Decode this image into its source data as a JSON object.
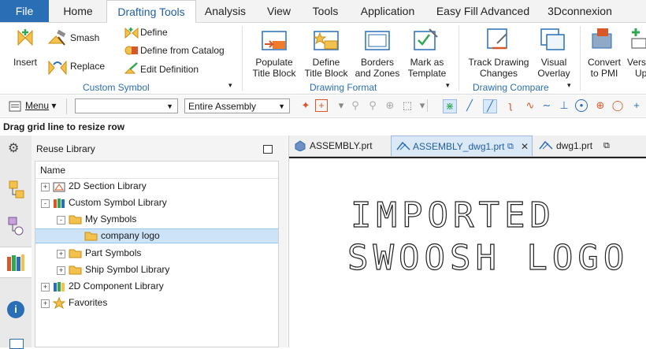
{
  "menu": {
    "tabs": [
      "File",
      "Home",
      "Drafting Tools",
      "Analysis",
      "View",
      "Tools",
      "Application",
      "Easy Fill Advanced",
      "3Dconnexion"
    ],
    "active": "Drafting Tools"
  },
  "ribbon": {
    "custom_symbol": {
      "group_label": "Custom Symbol",
      "insert": "Insert",
      "smash": "Smash",
      "replace": "Replace",
      "define": "Define",
      "define_from_catalog": "Define from Catalog",
      "edit_definition": "Edit Definition"
    },
    "drawing_format": {
      "group_label": "Drawing Format",
      "populate_title_block": [
        "Populate",
        "Title Block"
      ],
      "define_title_block": [
        "Define",
        "Title Block"
      ],
      "borders_and_zones": [
        "Borders",
        "and Zones"
      ],
      "mark_as_template": [
        "Mark as",
        "Template"
      ]
    },
    "drawing_compare": {
      "group_label": "Drawing Compare",
      "track_drawing_changes": [
        "Track Drawing",
        "Changes"
      ],
      "visual_overlay": [
        "Visual",
        "Overlay"
      ]
    },
    "convert_to_pmi": [
      "Convert",
      "to PMI"
    ],
    "version_up": [
      "Vers",
      "Up"
    ]
  },
  "toolbar": {
    "menu_label": "Menu",
    "filter_value": "",
    "scope_value": "Entire Assembly"
  },
  "status": {
    "text": "Drag grid line to resize row"
  },
  "reuse_library": {
    "title": "Reuse Library",
    "column_header": "Name",
    "nodes": [
      {
        "label": "2D Section Library",
        "expander": "+"
      },
      {
        "label": "Custom Symbol Library",
        "expander": "-"
      },
      {
        "label": "My Symbols",
        "expander": "-"
      },
      {
        "label": "company logo",
        "expander": "",
        "selected": true
      },
      {
        "label": "Part Symbols",
        "expander": "+"
      },
      {
        "label": "Ship Symbol Library",
        "expander": "+"
      },
      {
        "label": "2D Component Library",
        "expander": "+"
      },
      {
        "label": "Favorites",
        "expander": "+"
      }
    ]
  },
  "documents": {
    "tabs": [
      "ASSEMBLY.prt",
      "ASSEMBLY_dwg1.prt",
      "dwg1.prt"
    ],
    "active": "ASSEMBLY_dwg1.prt",
    "canvas_lines": [
      "IMPORTED",
      "SWOOSH LOGO"
    ]
  },
  "colors": {
    "accent": "#2a6eb5",
    "selected_row": "#cde3f7",
    "folder": "#f2c14e"
  }
}
